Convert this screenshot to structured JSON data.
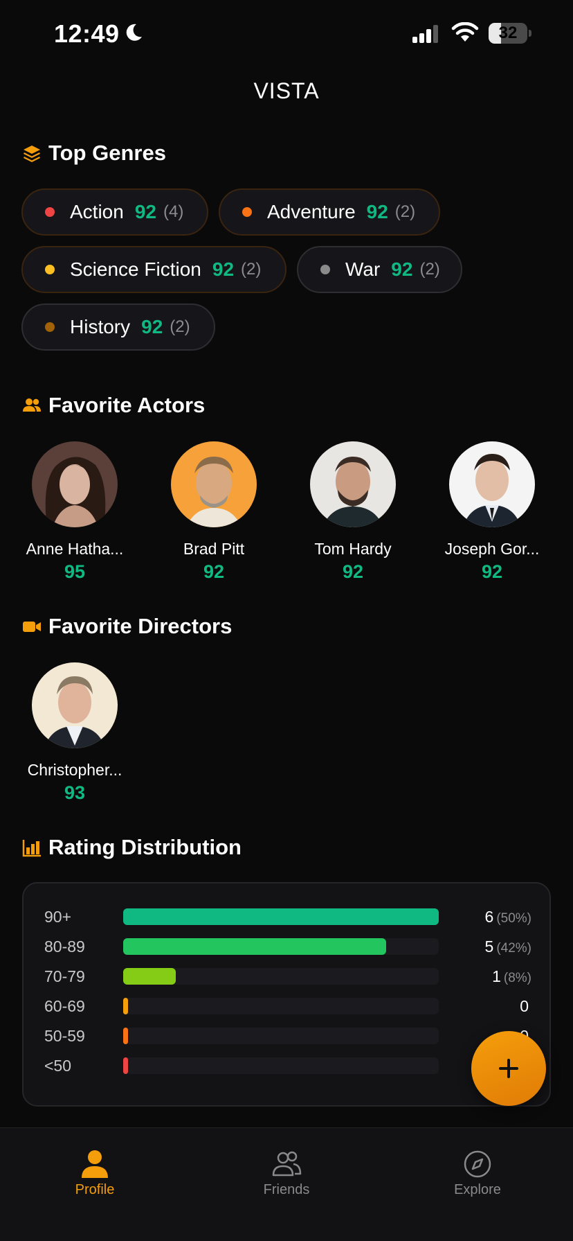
{
  "status_bar": {
    "time": "12:49",
    "battery": "32",
    "battery_level": 0.32
  },
  "app": {
    "title": "VISTA"
  },
  "top_genres": {
    "title": "Top Genres",
    "items": [
      {
        "name": "Action",
        "score": "92",
        "count": "(4)",
        "dot_color": "#ef4444"
      },
      {
        "name": "Adventure",
        "score": "92",
        "count": "(2)",
        "dot_color": "#f97316"
      },
      {
        "name": "Science Fiction",
        "score": "92",
        "count": "(2)",
        "dot_color": "#fbbf24"
      },
      {
        "name": "War",
        "score": "92",
        "count": "(2)",
        "dot_color": "#8a8a8a"
      },
      {
        "name": "History",
        "score": "92",
        "count": "(2)",
        "dot_color": "#a16207"
      }
    ]
  },
  "favorite_actors": {
    "title": "Favorite Actors",
    "items": [
      {
        "name": "Anne Hatha...",
        "score": "95"
      },
      {
        "name": "Brad Pitt",
        "score": "92"
      },
      {
        "name": "Tom Hardy",
        "score": "92"
      },
      {
        "name": "Joseph Gor...",
        "score": "92"
      }
    ]
  },
  "favorite_directors": {
    "title": "Favorite Directors",
    "items": [
      {
        "name": "Christopher...",
        "score": "93"
      }
    ]
  },
  "rating_distribution": {
    "title": "Rating Distribution",
    "rows": [
      {
        "label": "90+",
        "count": "6",
        "percent": "(50%)",
        "fraction": 1.0,
        "color": "#10b981"
      },
      {
        "label": "80-89",
        "count": "5",
        "percent": "(42%)",
        "fraction": 0.833,
        "color": "#22c55e"
      },
      {
        "label": "70-79",
        "count": "1",
        "percent": "(8%)",
        "fraction": 0.167,
        "color": "#84cc16"
      },
      {
        "label": "60-69",
        "count": "0",
        "percent": "",
        "fraction": 0,
        "color": "#f59e0b"
      },
      {
        "label": "50-59",
        "count": "0",
        "percent": "",
        "fraction": 0,
        "color": "#f97316"
      },
      {
        "label": "<50",
        "count": "0",
        "percent": "",
        "fraction": 0,
        "color": "#ef4444"
      }
    ]
  },
  "fab": {
    "icon": "plus-icon"
  },
  "tab_bar": {
    "tabs": [
      {
        "label": "Profile",
        "icon": "person-icon",
        "active": true
      },
      {
        "label": "Friends",
        "icon": "people-icon",
        "active": false
      },
      {
        "label": "Explore",
        "icon": "compass-icon",
        "active": false
      }
    ]
  },
  "colors": {
    "accent": "#f59e0b",
    "score": "#10b981",
    "background": "#0a0a0a"
  }
}
